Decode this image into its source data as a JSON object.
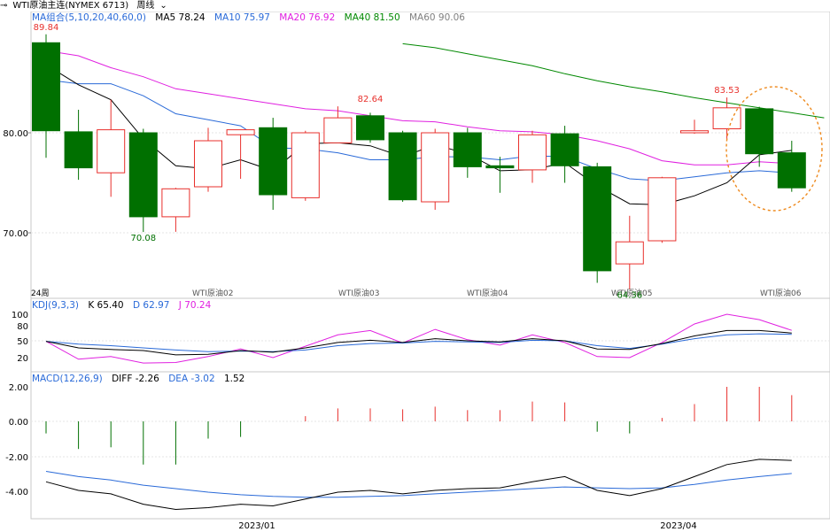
{
  "window": {
    "title": "WTI原油主连(NYMEX 6713)",
    "period": "周线"
  },
  "price_legend": {
    "label": "MA组合(5,10,20,40,60,0)",
    "ma5": "MA5 78.24",
    "ma10": "MA10 75.97",
    "ma20": "MA20 76.92",
    "ma40": "MA40 81.50",
    "ma60": "MA60 90.06"
  },
  "kdj_legend": {
    "label": "KDJ(9,3,3)",
    "k": "K 65.40",
    "d": "D 62.97",
    "j": "J 70.24"
  },
  "macd_legend": {
    "label": "MACD(12,26,9)",
    "diff": "DIFF -2.26",
    "dea": "DEA -3.02",
    "macd": "1.52"
  },
  "chart_data": {
    "type": "candlestick",
    "y_ticks": [
      "80.00",
      "70.00"
    ],
    "kdj_ticks": [
      "100",
      "80",
      "50",
      "20"
    ],
    "macd_ticks": [
      "2.00",
      "0.00",
      "-2.00",
      "-4.00"
    ],
    "x_labels": [
      "2023/01",
      "2023/04"
    ],
    "contract_markers": [
      "WTI原油02",
      "WTI原油03",
      "WTI原油04",
      "WTI原油05",
      "WTI原油06"
    ],
    "period_label": "24周",
    "annotations": [
      "89.84",
      "70.08",
      "82.64",
      "83.53",
      "64.36"
    ],
    "colors": {
      "up": "#e8302c",
      "down": "#007000",
      "ma5": "#000000",
      "ma10": "#2a6ad8",
      "ma20": "#e020e0",
      "ma40": "#008800",
      "ma60": "#808080"
    },
    "candles": [
      {
        "o": 89.0,
        "h": 89.84,
        "l": 77.5,
        "c": 80.2
      },
      {
        "o": 80.1,
        "h": 82.3,
        "l": 75.3,
        "c": 76.5
      },
      {
        "o": 76.0,
        "h": 83.3,
        "l": 73.6,
        "c": 80.3
      },
      {
        "o": 80.0,
        "h": 80.4,
        "l": 70.08,
        "c": 71.6
      },
      {
        "o": 71.6,
        "h": 74.5,
        "l": 70.1,
        "c": 74.4
      },
      {
        "o": 74.6,
        "h": 80.5,
        "l": 74.1,
        "c": 79.2
      },
      {
        "o": 79.8,
        "h": 80.3,
        "l": 75.4,
        "c": 80.3
      },
      {
        "o": 80.5,
        "h": 81.5,
        "l": 72.3,
        "c": 73.8
      },
      {
        "o": 73.5,
        "h": 80.2,
        "l": 73.2,
        "c": 80.0
      },
      {
        "o": 79.0,
        "h": 82.64,
        "l": 79.0,
        "c": 81.5
      },
      {
        "o": 81.7,
        "h": 82.0,
        "l": 79.0,
        "c": 79.3
      },
      {
        "o": 80.0,
        "h": 80.2,
        "l": 73.1,
        "c": 73.3
      },
      {
        "o": 73.1,
        "h": 80.4,
        "l": 72.3,
        "c": 80.0
      },
      {
        "o": 80.0,
        "h": 80.5,
        "l": 75.5,
        "c": 76.6
      },
      {
        "o": 76.7,
        "h": 77.6,
        "l": 74.0,
        "c": 76.5
      },
      {
        "o": 76.3,
        "h": 80.2,
        "l": 75.0,
        "c": 79.8
      },
      {
        "o": 79.9,
        "h": 80.7,
        "l": 75.0,
        "c": 76.7
      },
      {
        "o": 76.6,
        "h": 77.0,
        "l": 65.0,
        "c": 66.2
      },
      {
        "o": 66.9,
        "h": 71.7,
        "l": 64.36,
        "c": 69.1
      },
      {
        "o": 69.2,
        "h": 75.6,
        "l": 69.0,
        "c": 75.5
      },
      {
        "o": 80.0,
        "h": 81.3,
        "l": 79.9,
        "c": 80.2
      },
      {
        "o": 80.4,
        "h": 83.53,
        "l": 79.3,
        "c": 82.5
      },
      {
        "o": 82.4,
        "h": 82.6,
        "l": 76.6,
        "c": 77.9
      },
      {
        "o": 78.0,
        "h": 79.2,
        "l": 74.1,
        "c": 74.5
      }
    ],
    "ma5": [
      86.8,
      84.8,
      83.3,
      79.4,
      76.7,
      76.4,
      77.3,
      76.2,
      78.9,
      79.0,
      78.7,
      77.6,
      78.8,
      77.9,
      76.2,
      76.3,
      77.0,
      74.7,
      72.9,
      72.8,
      73.7,
      75.0,
      77.8,
      78.24
    ],
    "ma10": [
      85.3,
      84.9,
      84.9,
      83.7,
      81.9,
      81.3,
      80.7,
      78.5,
      78.4,
      78.0,
      77.3,
      77.3,
      77.6,
      77.6,
      77.3,
      77.7,
      77.6,
      76.4,
      75.4,
      75.2,
      75.6,
      76.0,
      76.2,
      75.97
    ],
    "ma20": [
      88.2,
      87.7,
      86.5,
      85.6,
      84.4,
      83.9,
      83.4,
      82.9,
      82.4,
      82.2,
      81.7,
      81.2,
      81.1,
      80.6,
      80.2,
      80.1,
      79.8,
      79.2,
      78.4,
      77.2,
      76.8,
      76.8,
      77.1,
      76.92
    ],
    "ma40_start": 11,
    "ma40": [
      88.9,
      88.5,
      87.9,
      87.3,
      86.7,
      85.9,
      85.2,
      84.6,
      84.1,
      83.5,
      83.0,
      82.5,
      82.0,
      81.5
    ],
    "ma60_start": 11,
    "ma60": [
      100.1,
      99.6,
      99.1,
      98.6,
      98.0,
      97.5,
      97.0,
      96.5,
      95.9,
      95.3,
      94.6,
      93.9,
      93.3,
      92.8,
      92.2,
      91.6,
      91.0,
      90.6,
      90.06
    ],
    "k": [
      50,
      38,
      35,
      33,
      25,
      26,
      33,
      30,
      38,
      48,
      52,
      48,
      55,
      51,
      49,
      55,
      51,
      36,
      35,
      46,
      60,
      70,
      70,
      65.4
    ],
    "d": [
      50,
      45,
      42,
      38,
      34,
      31,
      32,
      31,
      34,
      42,
      46,
      47,
      50,
      49,
      48,
      52,
      51,
      42,
      37,
      45,
      55,
      62,
      64,
      62.97
    ],
    "j": [
      50,
      17,
      22,
      10,
      11,
      22,
      36,
      20,
      41,
      62,
      70,
      47,
      72,
      53,
      43,
      62,
      48,
      22,
      20,
      48,
      82,
      100,
      90,
      70.24
    ],
    "macd_hist": [
      -0.7,
      -1.6,
      -1.5,
      -2.5,
      -2.5,
      -1.0,
      -0.9,
      0.0,
      0.3,
      0.75,
      0.75,
      0.7,
      0.85,
      0.65,
      0.65,
      1.15,
      1.1,
      -0.6,
      -0.7,
      0.2,
      1.0,
      2.0,
      2.0,
      1.52
    ],
    "diff": [
      -3.5,
      -4.0,
      -4.2,
      -4.8,
      -5.1,
      -5.0,
      -4.8,
      -4.9,
      -4.5,
      -4.1,
      -4.0,
      -4.2,
      -4.0,
      -3.9,
      -3.85,
      -3.5,
      -3.2,
      -4.0,
      -4.3,
      -3.9,
      -3.2,
      -2.5,
      -2.2,
      -2.26
    ],
    "dea": [
      -2.9,
      -3.2,
      -3.4,
      -3.7,
      -3.9,
      -4.1,
      -4.25,
      -4.35,
      -4.4,
      -4.4,
      -4.35,
      -4.3,
      -4.2,
      -4.1,
      -4.0,
      -3.9,
      -3.8,
      -3.85,
      -3.9,
      -3.85,
      -3.65,
      -3.4,
      -3.2,
      -3.02
    ]
  }
}
